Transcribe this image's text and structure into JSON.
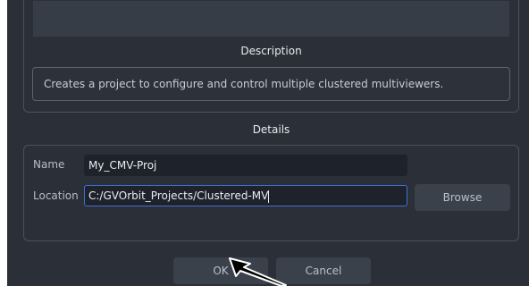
{
  "description": {
    "title": "Description",
    "text": "Creates a project to configure and control multiple clustered multiviewers."
  },
  "details": {
    "title": "Details",
    "name_label": "Name",
    "name_value": "My_CMV-Proj",
    "location_label": "Location",
    "location_value": "C:/GVOrbit_Projects/Clustered-MV",
    "browse_label": "Browse"
  },
  "footer": {
    "ok_label": "OK",
    "cancel_label": "Cancel"
  },
  "colors": {
    "dialog_bg": "#2b3038",
    "input_bg": "#1e232b",
    "focus_border": "#3f6fd8",
    "button_bg": "#3a414b"
  },
  "icons": {
    "cursor": "mouse-pointer-arrow-icon"
  }
}
